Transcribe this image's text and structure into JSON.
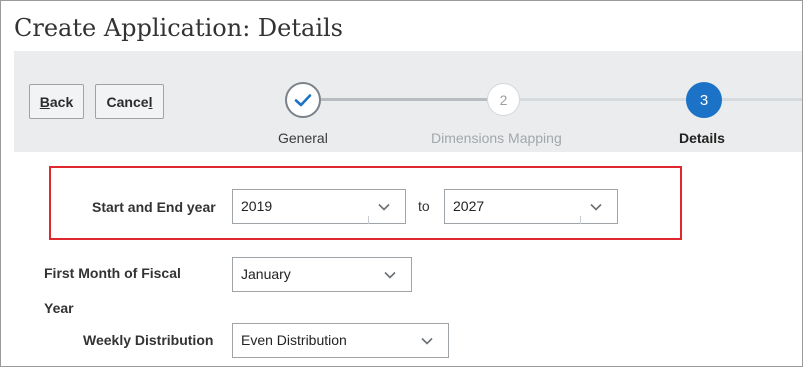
{
  "page": {
    "title": "Create Application: Details"
  },
  "toolbar": {
    "back_label_pre": "",
    "back_label_access": "B",
    "back_label_post": "ack",
    "cancel_label_pre": "Cance",
    "cancel_label_access": "l",
    "cancel_label_post": ""
  },
  "train": {
    "steps": [
      {
        "number": "",
        "label": "General",
        "state": "completed",
        "icon": "checkmark-icon"
      },
      {
        "number": "2",
        "label": "Dimensions Mapping",
        "state": "disabled"
      },
      {
        "number": "3",
        "label": "Details",
        "state": "current"
      }
    ]
  },
  "form": {
    "start_end": {
      "label": "Start and End year",
      "start_value": "2019",
      "separator": "to",
      "end_value": "2027"
    },
    "first_month": {
      "label_line1": "First Month of Fiscal",
      "label_line2": "Year",
      "value": "January"
    },
    "weekly_distribution": {
      "label": "Weekly Distribution",
      "value": "Even Distribution"
    }
  },
  "colors": {
    "accent": "#1b72c7",
    "highlight": "#e0282f",
    "train_bg": "#ebeced"
  }
}
